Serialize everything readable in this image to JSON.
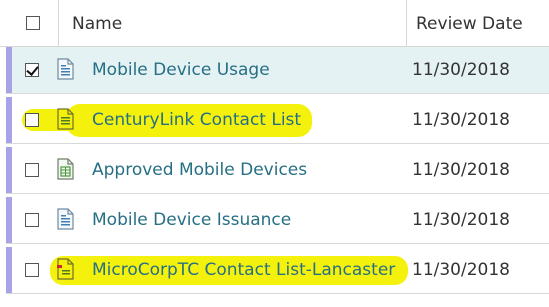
{
  "header": {
    "name_label": "Name",
    "date_label": "Review Date"
  },
  "rows": [
    {
      "title": "Mobile Device Usage",
      "date": "11/30/2018",
      "checked": true,
      "icon": "document-icon"
    },
    {
      "title": "CenturyLink Contact List",
      "date": "11/30/2018",
      "checked": false,
      "icon": "document-yellow-icon",
      "highlight": "#f4f20d"
    },
    {
      "title": "Approved Mobile Devices",
      "date": "11/30/2018",
      "checked": false,
      "icon": "spreadsheet-icon"
    },
    {
      "title": "Mobile Device Issuance",
      "date": "11/30/2018",
      "checked": false,
      "icon": "document-icon"
    },
    {
      "title": "MicroCorpTC Contact List-Lancaster",
      "date": "11/30/2018",
      "checked": false,
      "icon": "document-flagged-icon",
      "highlight": "#f4f20d"
    }
  ],
  "colors": {
    "accent_bar": "#a8a3e6",
    "link": "#266f84",
    "selected_row": "#e4f2f4"
  }
}
